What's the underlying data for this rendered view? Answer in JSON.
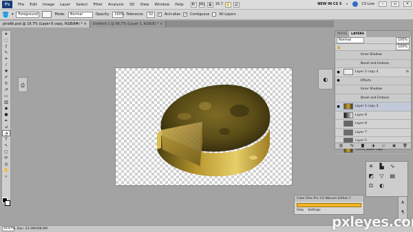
{
  "app": {
    "logo": "Ps"
  },
  "menu": [
    "File",
    "Edit",
    "Image",
    "Layer",
    "Select",
    "Filter",
    "Analysis",
    "3D",
    "View",
    "Window",
    "Help"
  ],
  "menubar_right": {
    "zoom": "16.7",
    "workspace": "NEW IN CS 5",
    "cs_live": "CS Live"
  },
  "options": {
    "preset": "Foreground",
    "mode_label": "Mode:",
    "mode_value": "Normal",
    "opacity_label": "Opacity:",
    "opacity_value": "100%",
    "tolerance_label": "Tolerance:",
    "tolerance_value": "32",
    "antialias_label": "Anti-alias",
    "contiguous_label": "Contiguous",
    "alllayers_label": "All Layers"
  },
  "tabs": [
    {
      "label": "pins6k.psd @ 16.7% (Layer 6 copy, RGB/8#) *",
      "active": true
    },
    {
      "label": "Untitled-1 @ 66.7% (Layer 1, RGB/8) *",
      "active": false
    }
  ],
  "layers_panel": {
    "tabs": [
      "PATHS",
      "LAYERS"
    ],
    "blend_mode": "Normal",
    "opacity": "100%",
    "fill": "100%",
    "rows": [
      {
        "kind": "sub",
        "text": "Inner Shadow",
        "eye": ""
      },
      {
        "kind": "sub",
        "text": "Bevel and Emboss",
        "eye": ""
      },
      {
        "kind": "layer",
        "name": "Layer 2 copy 4",
        "eye": "●",
        "thumb": "plain",
        "fx": "fx"
      },
      {
        "kind": "sub",
        "text": "Effects",
        "eye": "●"
      },
      {
        "kind": "sub",
        "text": "Inner Shadow",
        "eye": ""
      },
      {
        "kind": "sub",
        "text": "Bevel and Emboss",
        "eye": ""
      },
      {
        "kind": "layer",
        "name": "Layer 1 copy 3",
        "eye": "●",
        "thumb": "photo",
        "fx": ""
      },
      {
        "kind": "layer",
        "name": "Layer 8",
        "eye": "",
        "thumb": "grad",
        "fx": ""
      },
      {
        "kind": "layer",
        "name": "Layer 8",
        "eye": "",
        "thumb": "text",
        "fx": ""
      },
      {
        "kind": "layer",
        "name": "Layer 7",
        "eye": "",
        "thumb": "dark",
        "fx": ""
      },
      {
        "kind": "layer",
        "name": "Layer 5",
        "eye": "",
        "thumb": "text",
        "fx": ""
      },
      {
        "kind": "layer",
        "name": "70314_8886 copy",
        "eye": "",
        "thumb": "photo",
        "fx": ""
      }
    ]
  },
  "efex_panel": {
    "title": "Color Efex Pro 3.0 Wacom Edition f",
    "tabs": [
      "Help",
      "Settings"
    ]
  },
  "status": {
    "zoom": "16.67%",
    "doc": "Doc: 23.2M/408.6M"
  },
  "watermark": "pxleyes.com",
  "colors": {
    "accent": "#f3b428",
    "canvas_bg": "#a3a3a3",
    "foreground": "#000000",
    "background": "#ffffff"
  }
}
